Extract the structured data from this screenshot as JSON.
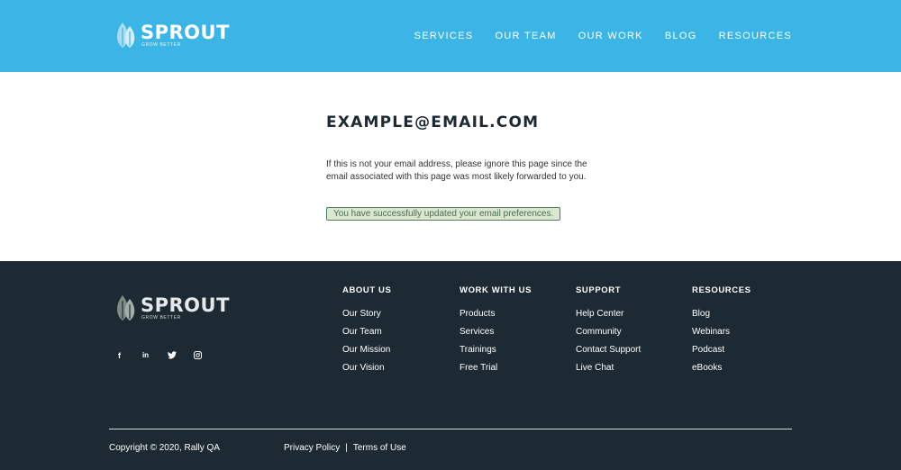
{
  "brand": {
    "name": "SPROUT",
    "tagline": "GROW BETTER"
  },
  "nav": {
    "items": [
      "SERVICES",
      "OUR TEAM",
      "OUR WORK",
      "BLOG",
      "RESOURCES"
    ]
  },
  "main": {
    "email": "EXAMPLE@EMAIL.COM",
    "message": "If this is not your email address, please ignore this page since the email associated with this page was most likely forwarded to you.",
    "success": "You have successfully updated your email preferences."
  },
  "footer": {
    "social": [
      {
        "icon": "facebook-icon",
        "glyph": "f"
      },
      {
        "icon": "linkedin-icon",
        "glyph": "in"
      },
      {
        "icon": "twitter-icon",
        "glyph": "🐦"
      },
      {
        "icon": "instagram-icon",
        "glyph": "◎"
      }
    ],
    "columns": [
      {
        "title": "ABOUT US",
        "links": [
          "Our Story",
          "Our Team",
          "Our Mission",
          "Our Vision"
        ]
      },
      {
        "title": "WORK WITH US",
        "links": [
          "Products",
          "Services",
          "Trainings",
          "Free Trial"
        ]
      },
      {
        "title": "SUPPORT",
        "links": [
          "Help Center",
          "Community",
          "Contact Support",
          "Live Chat"
        ]
      },
      {
        "title": "RESOURCES",
        "links": [
          "Blog",
          "Webinars",
          "Podcast",
          "eBooks"
        ]
      }
    ],
    "copyright": "Copyright © 2020, Rally QA",
    "legal": {
      "privacy": "Privacy Policy",
      "separator": "|",
      "terms": "Terms of Use"
    }
  },
  "colors": {
    "header": "#3bb5e5",
    "footer": "#1e2a33",
    "success_bg": "#d9e8cf",
    "success_border": "#4e7a5e"
  }
}
